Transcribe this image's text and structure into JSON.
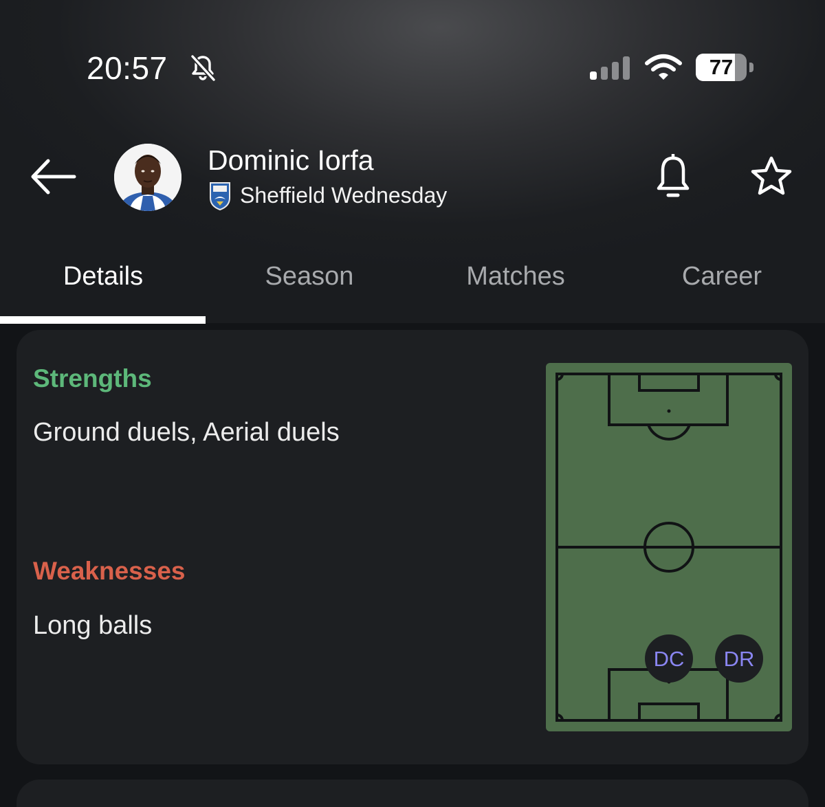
{
  "status_bar": {
    "time": "20:57",
    "battery_level": 77,
    "battery_text": "77",
    "icons": [
      "bell-slash-icon",
      "cellular-signal-icon",
      "wifi-icon",
      "battery-icon"
    ]
  },
  "header": {
    "back_icon": "arrow-left-icon",
    "player_name": "Dominic Iorfa",
    "club_name": "Sheffield Wednesday",
    "notify_icon": "bell-icon",
    "favorite_icon": "star-icon"
  },
  "tabs": [
    {
      "label": "Details",
      "active": true
    },
    {
      "label": "Season",
      "active": false
    },
    {
      "label": "Matches",
      "active": false
    },
    {
      "label": "Career",
      "active": false
    }
  ],
  "details": {
    "strengths_title": "Strengths",
    "strengths": "Ground duels, Aerial duels",
    "weaknesses_title": "Weaknesses",
    "weaknesses": "Long balls"
  },
  "pitch": {
    "positions": [
      "DC",
      "DR"
    ]
  },
  "colors": {
    "strengths": "#5db87a",
    "weaknesses": "#d9614b",
    "pitch": "#4e6e4b",
    "position_text": "#8a86f2",
    "card": "#1d1f22"
  }
}
